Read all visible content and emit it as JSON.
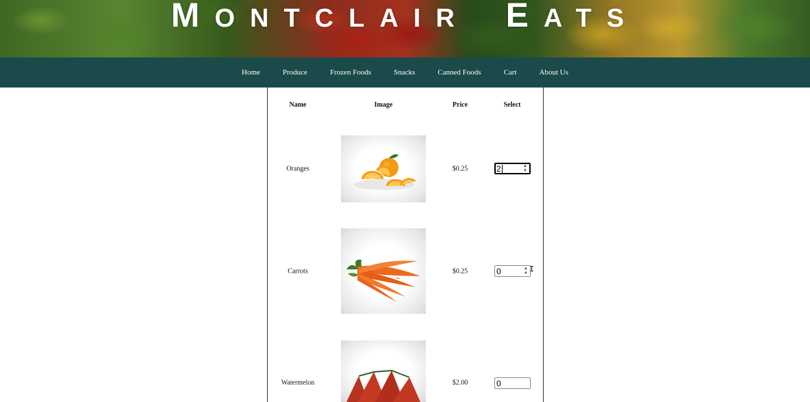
{
  "site": {
    "title_first_big": "M",
    "title_first_rest": "ONTCLAIR",
    "title_second_big": "E",
    "title_second_rest": "ATS"
  },
  "nav": {
    "items": [
      "Home",
      "Produce",
      "Frozen Foods",
      "Snacks",
      "Canned Foods",
      "Cart",
      "About Us"
    ]
  },
  "table": {
    "headers": {
      "name": "Name",
      "image": "Image",
      "price": "Price",
      "select": "Select"
    },
    "rows": [
      {
        "name": "Oranges",
        "image_icon": "oranges-image",
        "price": "$0.25",
        "quantity": "2"
      },
      {
        "name": "Carrots",
        "image_icon": "carrots-image",
        "price": "$0.25",
        "quantity": "0"
      },
      {
        "name": "Watermelon",
        "image_icon": "watermelon-image",
        "price": "$2.00",
        "quantity": "0"
      }
    ]
  },
  "colors": {
    "nav_background": "#1a4a4a",
    "nav_text": "#ffffff",
    "title_text": "#ffffff"
  }
}
